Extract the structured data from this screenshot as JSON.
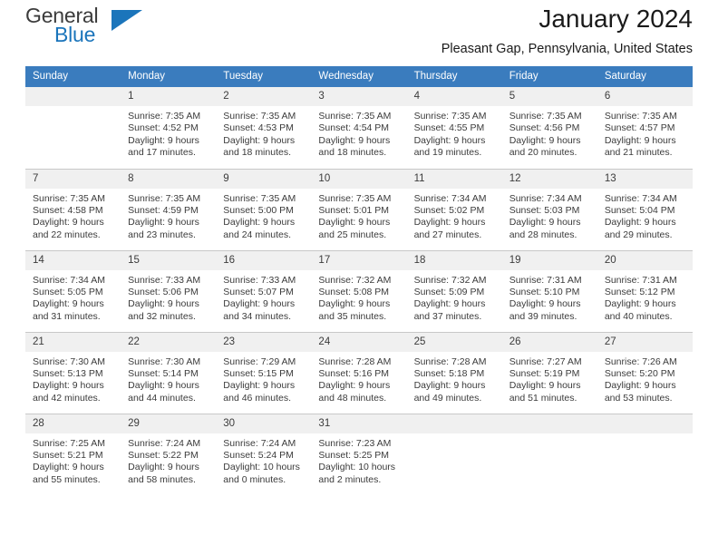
{
  "brand": {
    "line1": "General",
    "line2": "Blue",
    "triangle_color": "#1b75bb",
    "text_color": "#3b3b3b"
  },
  "header": {
    "title": "January 2024",
    "subtitle": "Pleasant Gap, Pennsylvania, United States"
  },
  "calendar": {
    "header_color": "#3a7cbe",
    "daynum_bg": "#f0f0f0",
    "weekday_headers": [
      "Sunday",
      "Monday",
      "Tuesday",
      "Wednesday",
      "Thursday",
      "Friday",
      "Saturday"
    ],
    "weeks": [
      [
        {
          "day": "",
          "sunrise": "",
          "sunset": "",
          "daylight": ""
        },
        {
          "day": "1",
          "sunrise": "Sunrise: 7:35 AM",
          "sunset": "Sunset: 4:52 PM",
          "daylight": "Daylight: 9 hours and 17 minutes."
        },
        {
          "day": "2",
          "sunrise": "Sunrise: 7:35 AM",
          "sunset": "Sunset: 4:53 PM",
          "daylight": "Daylight: 9 hours and 18 minutes."
        },
        {
          "day": "3",
          "sunrise": "Sunrise: 7:35 AM",
          "sunset": "Sunset: 4:54 PM",
          "daylight": "Daylight: 9 hours and 18 minutes."
        },
        {
          "day": "4",
          "sunrise": "Sunrise: 7:35 AM",
          "sunset": "Sunset: 4:55 PM",
          "daylight": "Daylight: 9 hours and 19 minutes."
        },
        {
          "day": "5",
          "sunrise": "Sunrise: 7:35 AM",
          "sunset": "Sunset: 4:56 PM",
          "daylight": "Daylight: 9 hours and 20 minutes."
        },
        {
          "day": "6",
          "sunrise": "Sunrise: 7:35 AM",
          "sunset": "Sunset: 4:57 PM",
          "daylight": "Daylight: 9 hours and 21 minutes."
        }
      ],
      [
        {
          "day": "7",
          "sunrise": "Sunrise: 7:35 AM",
          "sunset": "Sunset: 4:58 PM",
          "daylight": "Daylight: 9 hours and 22 minutes."
        },
        {
          "day": "8",
          "sunrise": "Sunrise: 7:35 AM",
          "sunset": "Sunset: 4:59 PM",
          "daylight": "Daylight: 9 hours and 23 minutes."
        },
        {
          "day": "9",
          "sunrise": "Sunrise: 7:35 AM",
          "sunset": "Sunset: 5:00 PM",
          "daylight": "Daylight: 9 hours and 24 minutes."
        },
        {
          "day": "10",
          "sunrise": "Sunrise: 7:35 AM",
          "sunset": "Sunset: 5:01 PM",
          "daylight": "Daylight: 9 hours and 25 minutes."
        },
        {
          "day": "11",
          "sunrise": "Sunrise: 7:34 AM",
          "sunset": "Sunset: 5:02 PM",
          "daylight": "Daylight: 9 hours and 27 minutes."
        },
        {
          "day": "12",
          "sunrise": "Sunrise: 7:34 AM",
          "sunset": "Sunset: 5:03 PM",
          "daylight": "Daylight: 9 hours and 28 minutes."
        },
        {
          "day": "13",
          "sunrise": "Sunrise: 7:34 AM",
          "sunset": "Sunset: 5:04 PM",
          "daylight": "Daylight: 9 hours and 29 minutes."
        }
      ],
      [
        {
          "day": "14",
          "sunrise": "Sunrise: 7:34 AM",
          "sunset": "Sunset: 5:05 PM",
          "daylight": "Daylight: 9 hours and 31 minutes."
        },
        {
          "day": "15",
          "sunrise": "Sunrise: 7:33 AM",
          "sunset": "Sunset: 5:06 PM",
          "daylight": "Daylight: 9 hours and 32 minutes."
        },
        {
          "day": "16",
          "sunrise": "Sunrise: 7:33 AM",
          "sunset": "Sunset: 5:07 PM",
          "daylight": "Daylight: 9 hours and 34 minutes."
        },
        {
          "day": "17",
          "sunrise": "Sunrise: 7:32 AM",
          "sunset": "Sunset: 5:08 PM",
          "daylight": "Daylight: 9 hours and 35 minutes."
        },
        {
          "day": "18",
          "sunrise": "Sunrise: 7:32 AM",
          "sunset": "Sunset: 5:09 PM",
          "daylight": "Daylight: 9 hours and 37 minutes."
        },
        {
          "day": "19",
          "sunrise": "Sunrise: 7:31 AM",
          "sunset": "Sunset: 5:10 PM",
          "daylight": "Daylight: 9 hours and 39 minutes."
        },
        {
          "day": "20",
          "sunrise": "Sunrise: 7:31 AM",
          "sunset": "Sunset: 5:12 PM",
          "daylight": "Daylight: 9 hours and 40 minutes."
        }
      ],
      [
        {
          "day": "21",
          "sunrise": "Sunrise: 7:30 AM",
          "sunset": "Sunset: 5:13 PM",
          "daylight": "Daylight: 9 hours and 42 minutes."
        },
        {
          "day": "22",
          "sunrise": "Sunrise: 7:30 AM",
          "sunset": "Sunset: 5:14 PM",
          "daylight": "Daylight: 9 hours and 44 minutes."
        },
        {
          "day": "23",
          "sunrise": "Sunrise: 7:29 AM",
          "sunset": "Sunset: 5:15 PM",
          "daylight": "Daylight: 9 hours and 46 minutes."
        },
        {
          "day": "24",
          "sunrise": "Sunrise: 7:28 AM",
          "sunset": "Sunset: 5:16 PM",
          "daylight": "Daylight: 9 hours and 48 minutes."
        },
        {
          "day": "25",
          "sunrise": "Sunrise: 7:28 AM",
          "sunset": "Sunset: 5:18 PM",
          "daylight": "Daylight: 9 hours and 49 minutes."
        },
        {
          "day": "26",
          "sunrise": "Sunrise: 7:27 AM",
          "sunset": "Sunset: 5:19 PM",
          "daylight": "Daylight: 9 hours and 51 minutes."
        },
        {
          "day": "27",
          "sunrise": "Sunrise: 7:26 AM",
          "sunset": "Sunset: 5:20 PM",
          "daylight": "Daylight: 9 hours and 53 minutes."
        }
      ],
      [
        {
          "day": "28",
          "sunrise": "Sunrise: 7:25 AM",
          "sunset": "Sunset: 5:21 PM",
          "daylight": "Daylight: 9 hours and 55 minutes."
        },
        {
          "day": "29",
          "sunrise": "Sunrise: 7:24 AM",
          "sunset": "Sunset: 5:22 PM",
          "daylight": "Daylight: 9 hours and 58 minutes."
        },
        {
          "day": "30",
          "sunrise": "Sunrise: 7:24 AM",
          "sunset": "Sunset: 5:24 PM",
          "daylight": "Daylight: 10 hours and 0 minutes."
        },
        {
          "day": "31",
          "sunrise": "Sunrise: 7:23 AM",
          "sunset": "Sunset: 5:25 PM",
          "daylight": "Daylight: 10 hours and 2 minutes."
        },
        {
          "day": "",
          "sunrise": "",
          "sunset": "",
          "daylight": ""
        },
        {
          "day": "",
          "sunrise": "",
          "sunset": "",
          "daylight": ""
        },
        {
          "day": "",
          "sunrise": "",
          "sunset": "",
          "daylight": ""
        }
      ]
    ]
  }
}
